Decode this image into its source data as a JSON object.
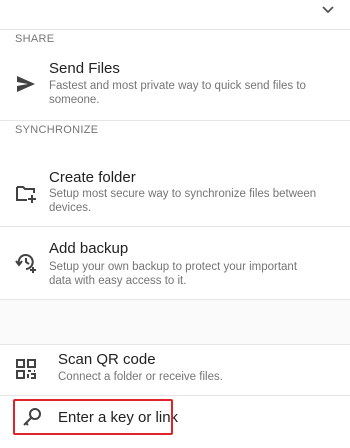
{
  "sections": {
    "share": "SHARE",
    "synchronize": "SYNCHRONIZE"
  },
  "items": {
    "send_files": {
      "title": "Send Files",
      "desc": "Fastest and most private way to quick send files to someone.",
      "icon": "send-icon"
    },
    "create_folder": {
      "title": "Create folder",
      "desc": "Setup most secure way to synchronize files between devices.",
      "icon": "create-folder-icon"
    },
    "add_backup": {
      "title": "Add backup",
      "desc": "Setup your own backup to protect your important data with easy access to it.",
      "icon": "backup-icon"
    },
    "scan_qr": {
      "title": "Scan QR code",
      "desc": "Connect a folder or receive files.",
      "icon": "qr-code-icon"
    },
    "enter_key": {
      "title": "Enter a key or link",
      "icon": "key-icon"
    }
  },
  "colors": {
    "highlight": "#e0222a",
    "text": "#212121",
    "secondary_text": "#757575"
  }
}
